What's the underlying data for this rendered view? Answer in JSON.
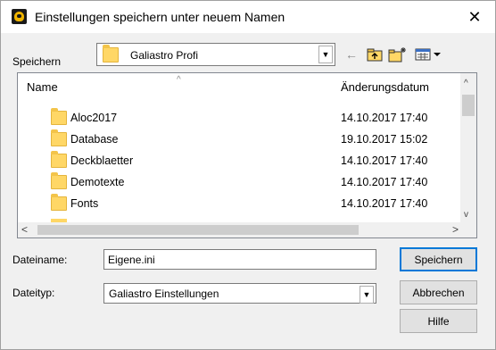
{
  "title": "Einstellungen speichern unter neuem Namen",
  "toolbar": {
    "save_in_label": "Speichern",
    "save_in_value": "Galiastro Profi"
  },
  "list": {
    "col_name": "Name",
    "col_date": "Änderungsdatum",
    "rows": [
      {
        "name": "Aloc2017",
        "date": "14.10.2017 17:40"
      },
      {
        "name": "Database",
        "date": "19.10.2017 15:02"
      },
      {
        "name": "Deckblaetter",
        "date": "14.10.2017 17:40"
      },
      {
        "name": "Demotexte",
        "date": "14.10.2017 17:40"
      },
      {
        "name": "Fonts",
        "date": "14.10.2017 17:40"
      }
    ]
  },
  "form": {
    "filename_label": "Dateiname:",
    "filename_value": "Eigene.ini",
    "filetype_label": "Dateityp:",
    "filetype_value": "Galiastro Einstellungen"
  },
  "buttons": {
    "save": "Speichern",
    "cancel": "Abbrechen",
    "help": "Hilfe"
  },
  "icons": {
    "app": "galiastro-app-icon",
    "close": "close-icon",
    "back": "back-arrow-icon",
    "up": "up-folder-icon",
    "new_folder": "new-folder-icon",
    "view": "view-menu-icon"
  }
}
